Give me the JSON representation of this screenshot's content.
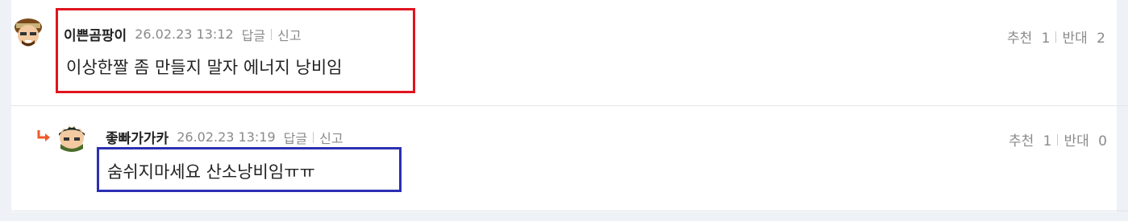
{
  "comments": [
    {
      "author": "이쁜곰팡이",
      "date": "26.02.23 13:12",
      "reply_label": "답글",
      "report_label": "신고",
      "text": "이상한짤 좀 만들지 말자 에너지 낭비임",
      "recommend_label": "추천",
      "recommend_count": "1",
      "oppose_label": "반대",
      "oppose_count": "2"
    },
    {
      "author": "좋빠가가카",
      "date": "26.02.23 13:19",
      "reply_label": "답글",
      "report_label": "신고",
      "text": "숨쉬지마세요 산소낭비임ㅠㅠ",
      "recommend_label": "추천",
      "recommend_count": "1",
      "oppose_label": "반대",
      "oppose_count": "0"
    }
  ],
  "colors": {
    "highlight_first": "#e0141e",
    "highlight_second": "#2b2fb2",
    "reply_arrow": "#f05a28"
  },
  "icons": {
    "reply_indicator": "reply-arrow-icon",
    "avatar": "avatar-icon"
  }
}
